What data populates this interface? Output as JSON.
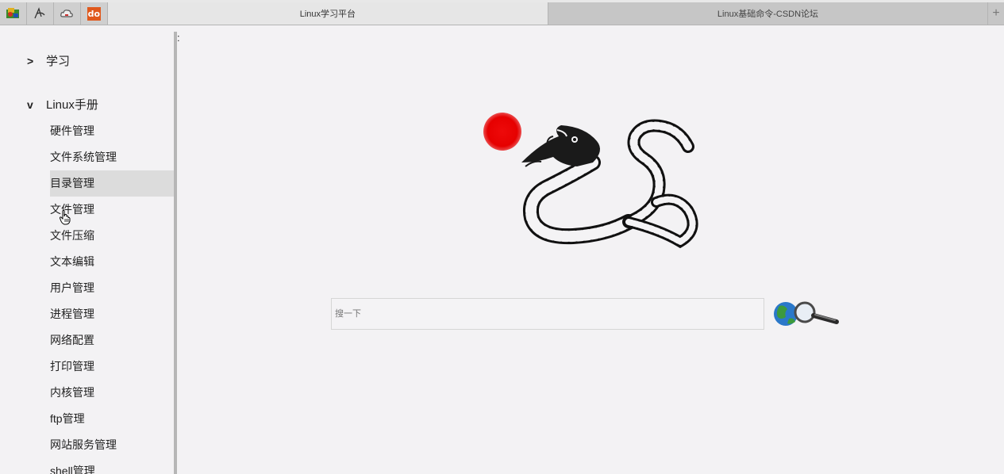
{
  "tabs": {
    "pinned": [
      {
        "icon": "app-icon"
      },
      {
        "icon": "signature-icon"
      },
      {
        "icon": "cloud-icon"
      },
      {
        "icon": "do-logo-icon",
        "label": "do"
      }
    ],
    "open": [
      {
        "title": "Linux学习平台",
        "active": true
      },
      {
        "title": "Linux基础命令-CSDN论坛",
        "active": false
      }
    ],
    "new_tab_label": "+"
  },
  "sidebar": {
    "colon": ":",
    "groups": [
      {
        "chevron": ">",
        "label": "学习",
        "expanded": false
      },
      {
        "chevron": "v",
        "label": "Linux手册",
        "expanded": true
      }
    ],
    "items": [
      {
        "label": "硬件管理"
      },
      {
        "label": "文件系统管理"
      },
      {
        "label": "目录管理",
        "selected": true
      },
      {
        "label": "文件管理"
      },
      {
        "label": "文件压缩"
      },
      {
        "label": "文本编辑"
      },
      {
        "label": "用户管理"
      },
      {
        "label": "进程管理"
      },
      {
        "label": "网络配置"
      },
      {
        "label": "打印管理"
      },
      {
        "label": "内核管理"
      },
      {
        "label": "ftp管理"
      },
      {
        "label": "网站服务管理"
      },
      {
        "label": "shell管理"
      }
    ]
  },
  "main": {
    "search": {
      "placeholder": "搜一下",
      "value": ""
    },
    "search_button_icon": "globe-magnifier-icon",
    "logo_icon": "snake-icon",
    "status_dot_color": "#e60000"
  }
}
